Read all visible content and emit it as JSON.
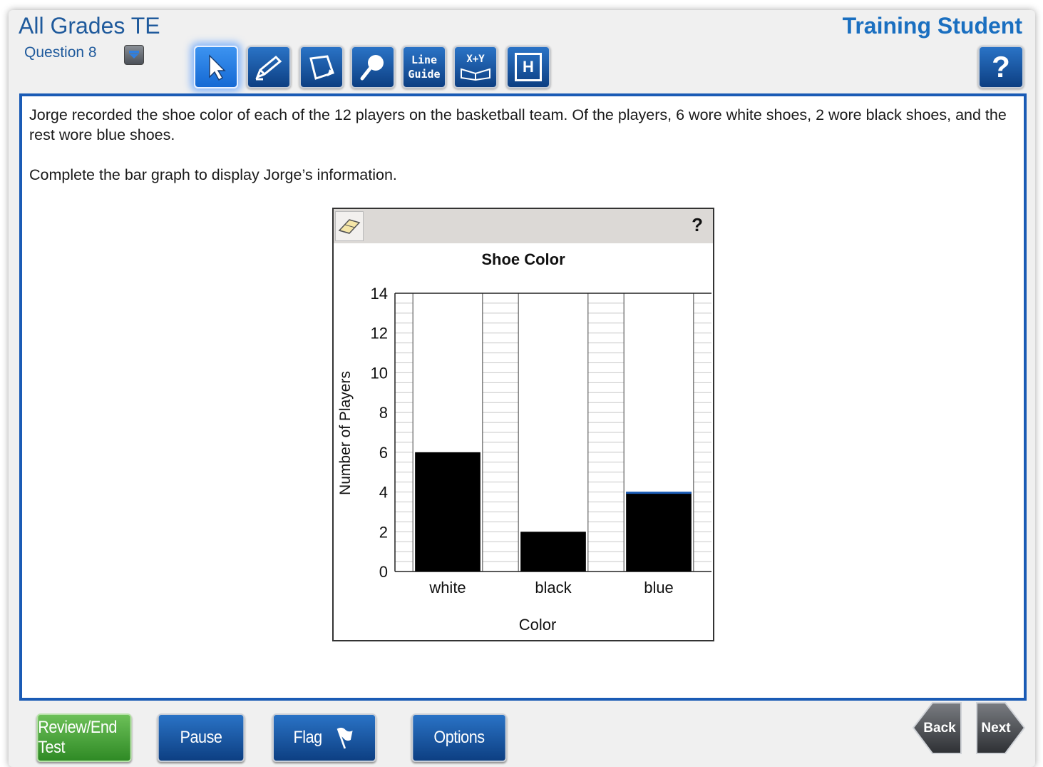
{
  "header": {
    "test_name": "All Grades TE",
    "question_label": "Question 8",
    "student_name": "Training Student",
    "help_label": "?"
  },
  "toolbar": {
    "tools": [
      {
        "name": "pointer",
        "icon": "pointer-arrow-icon",
        "active": true
      },
      {
        "name": "highlighter",
        "icon": "highlighter-icon"
      },
      {
        "name": "sticky-note",
        "icon": "note-icon"
      },
      {
        "name": "magnifier",
        "icon": "magnifier-icon"
      },
      {
        "name": "line-guide",
        "label_1": "Line",
        "label_2": "Guide"
      },
      {
        "name": "reference",
        "label": "X+Y",
        "icon": "book-icon"
      },
      {
        "name": "help-sheet",
        "label": "H"
      }
    ]
  },
  "question": {
    "paragraph_1": "Jorge recorded the shoe color of each of the 12 players on the basketball team. Of the players, 6 wore white shoes, 2 wore black shoes, and the rest wore blue shoes.",
    "paragraph_2": "Complete the bar graph to display Jorge’s information."
  },
  "graph_tool": {
    "help_label": "?",
    "eraser_icon": "eraser-icon"
  },
  "chart_data": {
    "type": "bar",
    "title": "Shoe Color",
    "xlabel": "Color",
    "ylabel": "Number of Players",
    "categories": [
      "white",
      "black",
      "blue"
    ],
    "values": [
      6,
      2,
      4
    ],
    "ylim": [
      0,
      14
    ],
    "yticks": [
      0,
      2,
      4,
      6,
      8,
      10,
      12,
      14
    ],
    "minor_grid_step": 0.5,
    "grid": true,
    "bar_color": "#000000",
    "selected_bar_edge": "#1a5bb5"
  },
  "footer": {
    "review_label": "Review/End Test",
    "pause_label": "Pause",
    "flag_label": "Flag",
    "options_label": "Options",
    "back_label": "Back",
    "next_label": "Next"
  },
  "colors": {
    "accent_blue": "#1a5bb5",
    "title_blue": "#1a6fc0",
    "review_green": "#3f9a33"
  }
}
